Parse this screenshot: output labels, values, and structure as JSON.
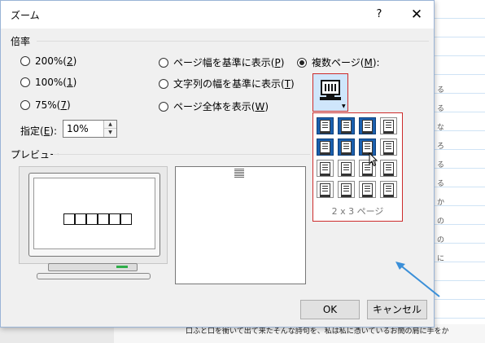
{
  "dialog": {
    "title": "ズーム",
    "help_icon": "?",
    "close_icon": "✕"
  },
  "zoom": {
    "section_label": "倍率",
    "options_col1": [
      {
        "label": "200%(",
        "key": "2",
        "suffix": ")",
        "checked": false
      },
      {
        "label": "100%(",
        "key": "1",
        "suffix": ")",
        "checked": false
      },
      {
        "label": "75%(",
        "key": "7",
        "suffix": ")",
        "checked": false
      }
    ],
    "options_col2": [
      {
        "label": "ページ幅を基準に表示(",
        "key": "P",
        "suffix": ")",
        "checked": false
      },
      {
        "label": "文字列の幅を基準に表示(",
        "key": "T",
        "suffix": ")",
        "checked": false
      },
      {
        "label": "ページ全体を表示(",
        "key": "W",
        "suffix": ")",
        "checked": false
      }
    ],
    "multi_page": {
      "label": "複数ページ(",
      "key": "M",
      "suffix": "):",
      "checked": true
    },
    "percent_label_pre": "指定(",
    "percent_label_key": "E",
    "percent_label_post": "):",
    "percent_value": "10%"
  },
  "page_grid": {
    "rows": 4,
    "cols": 4,
    "selected_rows": 2,
    "selected_cols": 3,
    "caption": "2 x 3 ページ"
  },
  "preview": {
    "section_label": "プレビュー",
    "sample_text": "□□□□□□"
  },
  "buttons": {
    "ok": "OK",
    "cancel": "キャンセル"
  },
  "background_doc": {
    "bottom_text": "口ふと口を衝いて出て来たそんな詩句を、私は私に憑いているお簡の肩に手をか",
    "side_glyphs": [
      "る",
      "る",
      "な",
      "ろ",
      "る",
      "る",
      "か",
      "の",
      "の",
      "に"
    ]
  },
  "colors": {
    "accent_selection": "#1a5fae",
    "highlight_border": "#cc2b2b",
    "button_hover_bg": "#cfe6fb",
    "arrow_annotation": "#3a8fd8"
  }
}
